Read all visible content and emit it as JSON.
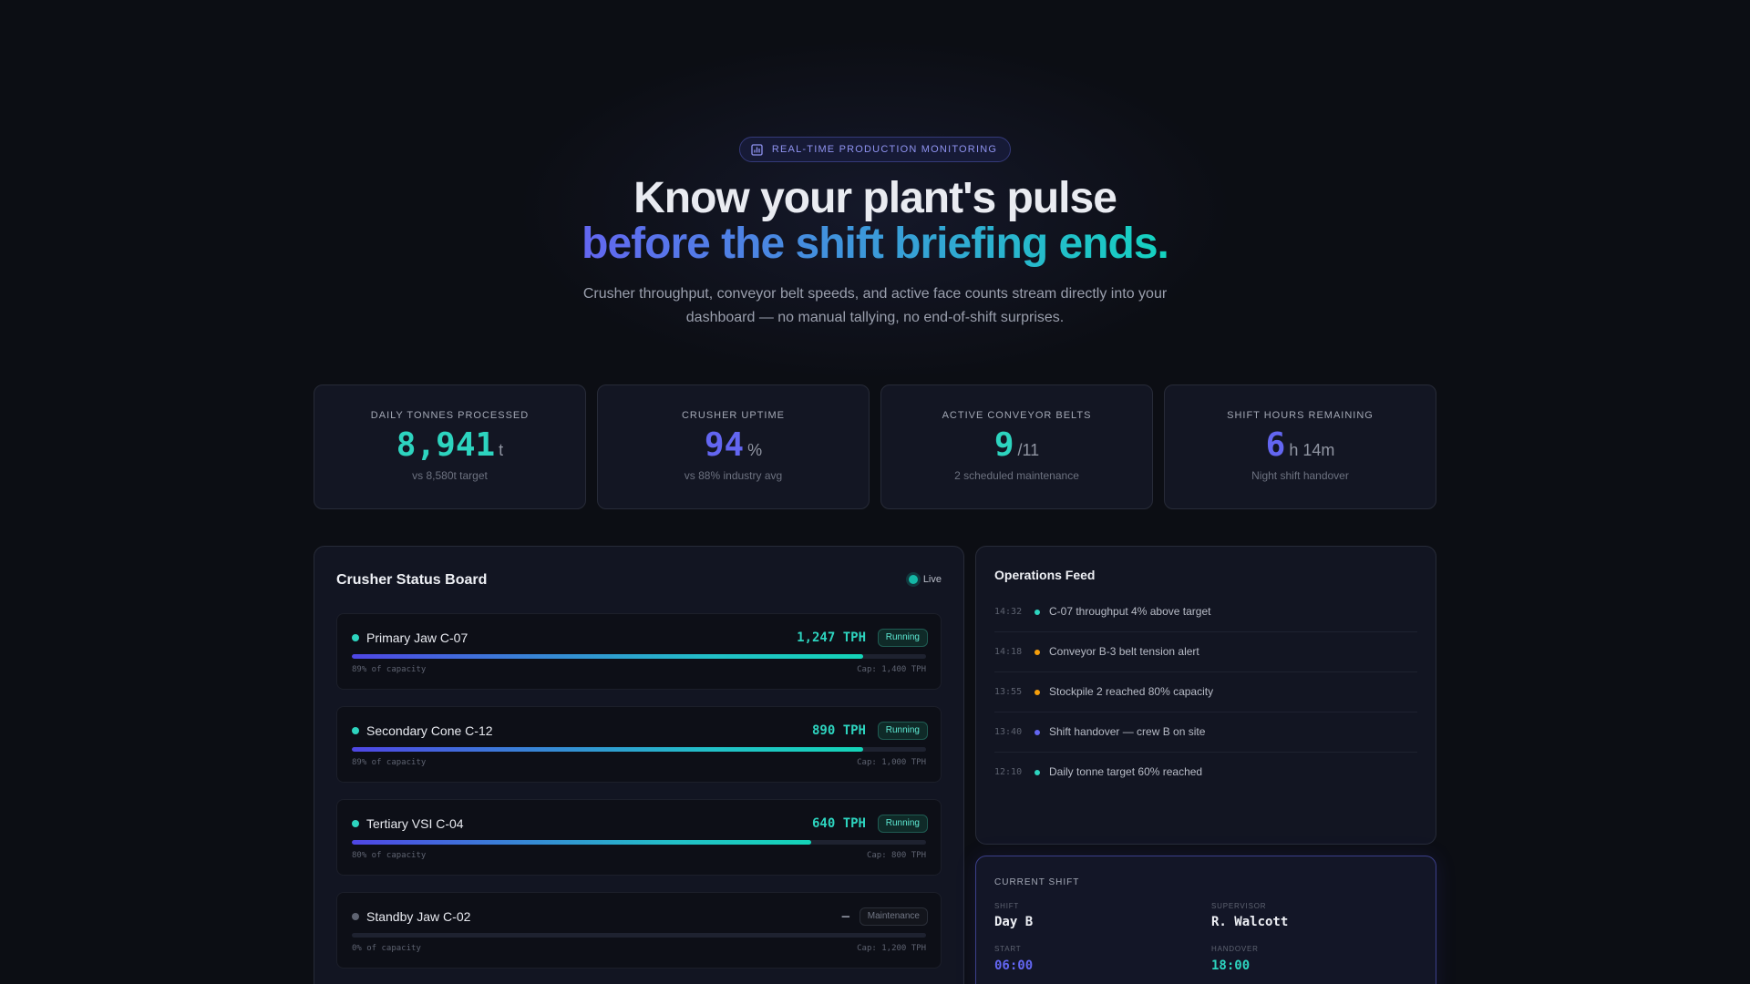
{
  "hero": {
    "badge": "REAL-TIME PRODUCTION MONITORING",
    "title_line1": "Know your plant's pulse",
    "title_line2": "before the shift briefing ends.",
    "subtitle": "Crusher throughput, conveyor belt speeds, and active face counts stream directly into your dashboard — no manual tallying, no end-of-shift surprises."
  },
  "stats": [
    {
      "label": "DAILY TONNES PROCESSED",
      "value": "8,941",
      "unit": "t",
      "note": "vs 8,580t target",
      "color": "#2dd4bf"
    },
    {
      "label": "CRUSHER UPTIME",
      "value": "94",
      "unit": "%",
      "note": "vs 88% industry avg",
      "color": "#6366f1"
    },
    {
      "label": "ACTIVE CONVEYOR BELTS",
      "value": "9",
      "unit": "/11",
      "note": "2 scheduled maintenance",
      "color": "#2dd4bf"
    },
    {
      "label": "SHIFT HOURS REMAINING",
      "value": "6",
      "unit": "h 14m",
      "note": "Night shift handover",
      "color": "#6366f1"
    }
  ],
  "board": {
    "title": "Crusher Status Board",
    "live_label": "Live",
    "crushers": [
      {
        "name": "Primary Jaw C-07",
        "tph": "1,247 TPH",
        "status": "Running",
        "capacity_text": "89% of capacity",
        "cap": "Cap: 1,400 TPH",
        "fill": 0.89,
        "dot_color": "#2dd4bf"
      },
      {
        "name": "Secondary Cone C-12",
        "tph": "890 TPH",
        "status": "Running",
        "capacity_text": "89% of capacity",
        "cap": "Cap: 1,000 TPH",
        "fill": 0.89,
        "dot_color": "#2dd4bf"
      },
      {
        "name": "Tertiary VSI C-04",
        "tph": "640 TPH",
        "status": "Running",
        "capacity_text": "80% of capacity",
        "cap": "Cap: 800 TPH",
        "fill": 0.8,
        "dot_color": "#2dd4bf"
      },
      {
        "name": "Standby Jaw C-02",
        "tph": "—",
        "status": "Maintenance",
        "capacity_text": "0% of capacity",
        "cap": "Cap: 1,200 TPH",
        "fill": 0.0,
        "dot_color": "#5e6371"
      }
    ]
  },
  "feed": {
    "title": "Operations Feed",
    "items": [
      {
        "time": "14:32",
        "text": "C-07 throughput 4% above target",
        "color": "#2dd4bf"
      },
      {
        "time": "14:18",
        "text": "Conveyor B-3 belt tension alert",
        "color": "#f59e0b"
      },
      {
        "time": "13:55",
        "text": "Stockpile 2 reached 80% capacity",
        "color": "#f59e0b"
      },
      {
        "time": "13:40",
        "text": "Shift handover — crew B on site",
        "color": "#6366f1"
      },
      {
        "time": "12:10",
        "text": "Daily tonne target 60% reached",
        "color": "#2dd4bf"
      }
    ]
  },
  "shift": {
    "title": "CURRENT SHIFT",
    "shift_label": "SHIFT",
    "shift_value": "Day B",
    "supervisor_label": "SUPERVISOR",
    "supervisor_value": "R. Walcott",
    "start_label": "START",
    "start_value": "06:00",
    "handover_label": "HANDOVER",
    "handover_value": "18:00"
  }
}
